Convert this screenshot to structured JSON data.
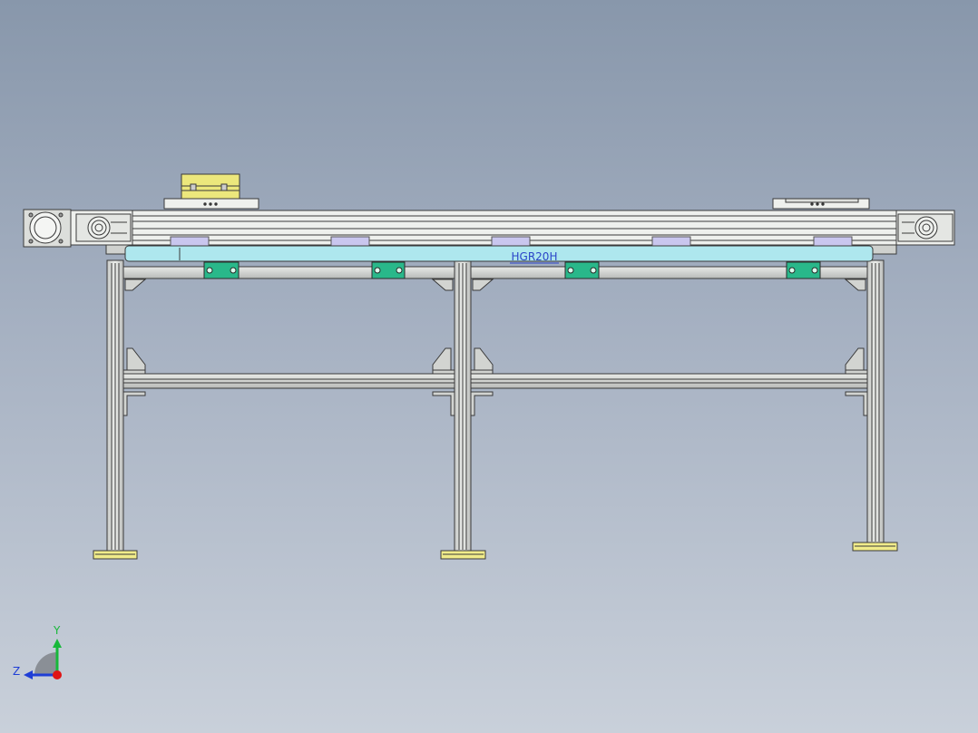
{
  "colors": {
    "frame_fill": "#d9dbd8",
    "frame_edge": "#3a3a3a",
    "belt_cyan": "#aee7ee",
    "carrier_green": "#29b88a",
    "pad_lilac": "#c9c6ee",
    "foot_yellow": "#f1ec8a",
    "motor_yellow": "#ece77c",
    "annotation_blue": "#2b45c8",
    "axis_y_green": "#17b83a",
    "axis_z_blue": "#1f3ed6",
    "origin_red": "#e01414"
  },
  "annotation": {
    "part_label": "HGR20H"
  },
  "triad": {
    "y_label": "Y",
    "z_label": "Z"
  }
}
